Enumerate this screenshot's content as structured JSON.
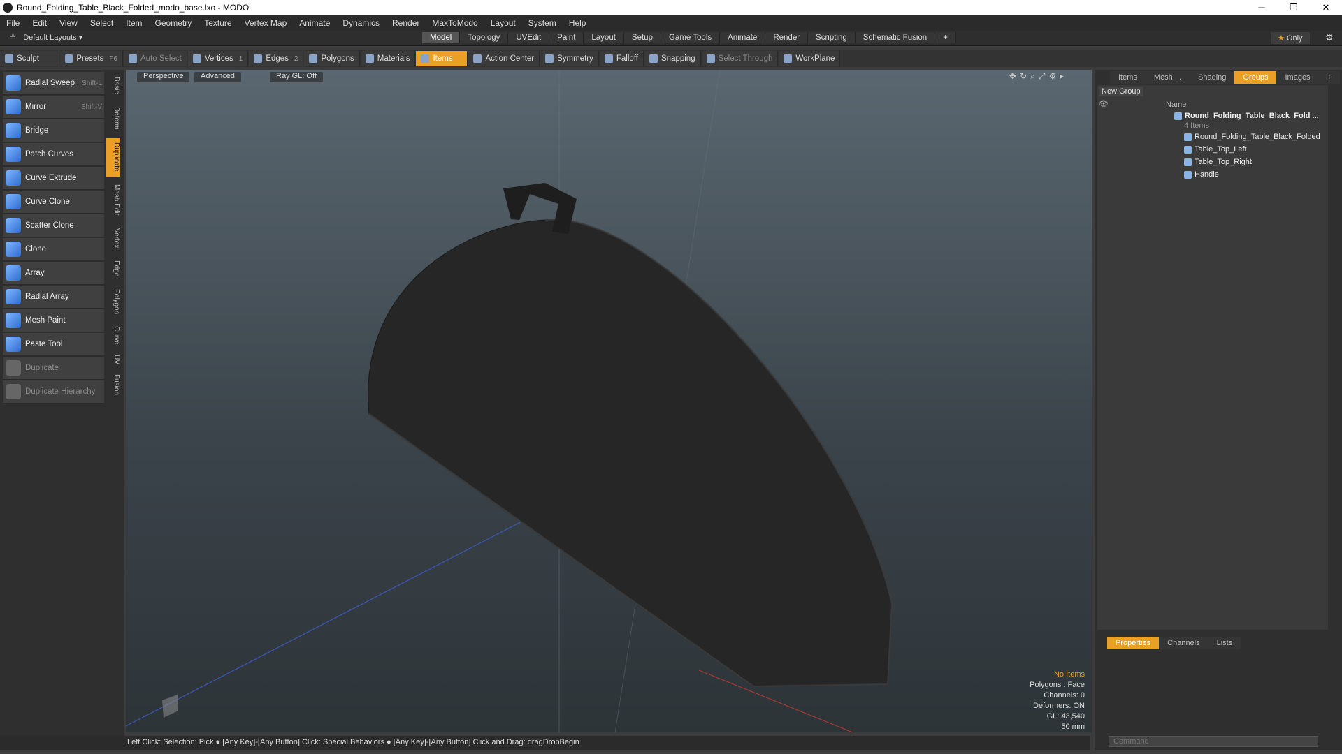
{
  "window": {
    "title": "Round_Folding_Table_Black_Folded_modo_base.lxo - MODO"
  },
  "menu": [
    "File",
    "Edit",
    "View",
    "Select",
    "Item",
    "Geometry",
    "Texture",
    "Vertex Map",
    "Animate",
    "Dynamics",
    "Render",
    "MaxToModo",
    "Layout",
    "System",
    "Help"
  ],
  "layout": {
    "preset": "Default Layouts ▾",
    "tabs": [
      "Model",
      "Topology",
      "UVEdit",
      "Paint",
      "Layout",
      "Setup",
      "Game Tools",
      "Animate",
      "Render",
      "Scripting",
      "Schematic Fusion"
    ],
    "active": "Model",
    "only": "Only"
  },
  "toolbar": {
    "sculpt": "Sculpt",
    "presets": "Presets",
    "presets_key": "F6",
    "auto_select": "Auto Select",
    "vertices": "Vertices",
    "vertices_n": "1",
    "edges": "Edges",
    "edges_n": "2",
    "polygons": "Polygons",
    "materials": "Materials",
    "items": "Items",
    "action_center": "Action Center",
    "symmetry": "Symmetry",
    "falloff": "Falloff",
    "snapping": "Snapping",
    "select_through": "Select Through",
    "workplane": "WorkPlane"
  },
  "tools": [
    {
      "label": "Radial Sweep",
      "key": "Shift-L"
    },
    {
      "label": "Mirror",
      "key": "Shift-V"
    },
    {
      "label": "Bridge",
      "key": ""
    },
    {
      "label": "Patch Curves",
      "key": ""
    },
    {
      "label": "Curve Extrude",
      "key": ""
    },
    {
      "label": "Curve Clone",
      "key": ""
    },
    {
      "label": "Scatter Clone",
      "key": ""
    },
    {
      "label": "Clone",
      "key": ""
    },
    {
      "label": "Array",
      "key": ""
    },
    {
      "label": "Radial Array",
      "key": ""
    },
    {
      "label": "Mesh Paint",
      "key": ""
    },
    {
      "label": "Paste Tool",
      "key": ""
    },
    {
      "label": "Duplicate",
      "key": ""
    },
    {
      "label": "Duplicate Hierarchy",
      "key": ""
    }
  ],
  "vtabs": [
    "Basic",
    "Deform",
    "Duplicate",
    "Mesh Edit",
    "Vertex",
    "Edge",
    "Polygon",
    "Curve",
    "UV",
    "Fusion"
  ],
  "viewport": {
    "view": "Perspective",
    "shading": "Advanced",
    "raygl": "Ray GL: Off",
    "info": [
      "No Items",
      "Polygons : Face",
      "Channels: 0",
      "Deformers: ON",
      "GL: 43,540",
      "50 mm"
    ]
  },
  "status": "Left Click: Selection: Pick ● [Any Key]-[Any Button] Click: Special Behaviors ● [Any Key]-[Any Button] Click and Drag: dragDropBegin",
  "right": {
    "tabs": [
      "Items",
      "Mesh ...",
      "Shading",
      "Groups",
      "Images"
    ],
    "active": "Groups",
    "new_group": "New Group",
    "name_col": "Name",
    "group_name": "Round_Folding_Table_Black_Fold ...",
    "group_count": "4 Items",
    "children": [
      "Round_Folding_Table_Black_Folded",
      "Table_Top_Left",
      "Table_Top_Right",
      "Handle"
    ],
    "bottom_tabs": [
      "Properties",
      "Channels",
      "Lists"
    ],
    "command_placeholder": "Command"
  }
}
